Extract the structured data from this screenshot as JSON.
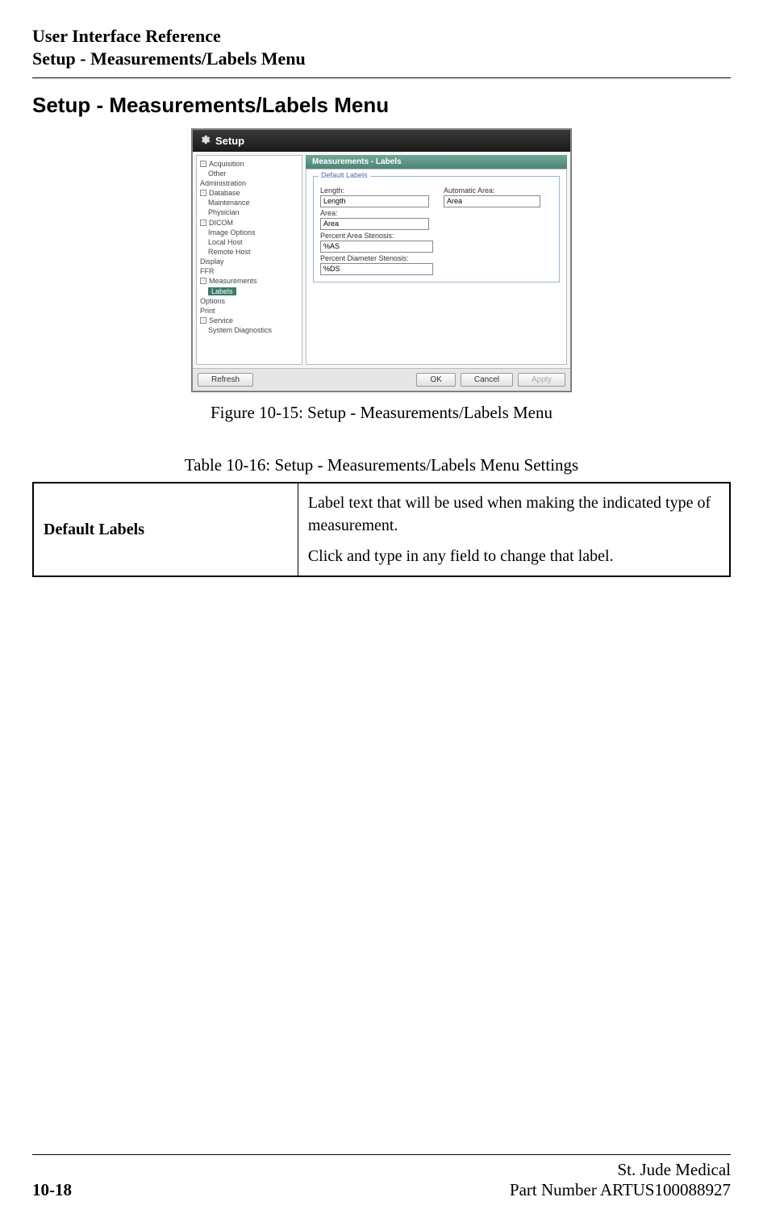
{
  "header": {
    "title": "User Interface Reference",
    "subtitle": "Setup - Measurements/Labels Menu"
  },
  "section_heading": "Setup - Measurements/Labels Menu",
  "dialog": {
    "title": "Setup",
    "crumb": "Measurements - Labels",
    "tree": {
      "acquisition": "Acquisition",
      "other": "Other",
      "administration": "Administration",
      "database": "Database",
      "maintenance": "Maintenance",
      "physician": "Physician",
      "dicom": "DICOM",
      "image_options": "Image Options",
      "local_host": "Local Host",
      "remote_host": "Remote Host",
      "display": "Display",
      "ffr": "FFR",
      "measurements": "Measurements",
      "labels": "Labels",
      "options": "Options",
      "print": "Print",
      "service": "Service",
      "system_diagnostics": "System Diagnostics"
    },
    "group_title": "Default Labels",
    "fields": {
      "length_label": "Length:",
      "length_value": "Length",
      "auto_area_label": "Automatic Area:",
      "auto_area_value": "Area",
      "area_label": "Area:",
      "area_value": "Area",
      "pas_label": "Percent Area Stenosis:",
      "pas_value": "%AS",
      "pds_label": "Percent Diameter Stenosis:",
      "pds_value": "%DS"
    },
    "buttons": {
      "refresh": "Refresh",
      "ok": "OK",
      "cancel": "Cancel",
      "apply": "Apply"
    }
  },
  "figure_caption": "Figure 10-15:  Setup - Measurements/Labels Menu",
  "table_caption": "Table 10-16:  Setup - Measurements/Labels Menu Settings",
  "table": {
    "row1_left": "Default Labels",
    "row1_right_p1": "Label text that will be used when making the indi­cated type of measurement.",
    "row1_right_p2": "Click and type in any field to change that label."
  },
  "footer": {
    "page": "10-18",
    "company": "St. Jude Medical",
    "partnum": "Part Number ARTUS100088927"
  }
}
